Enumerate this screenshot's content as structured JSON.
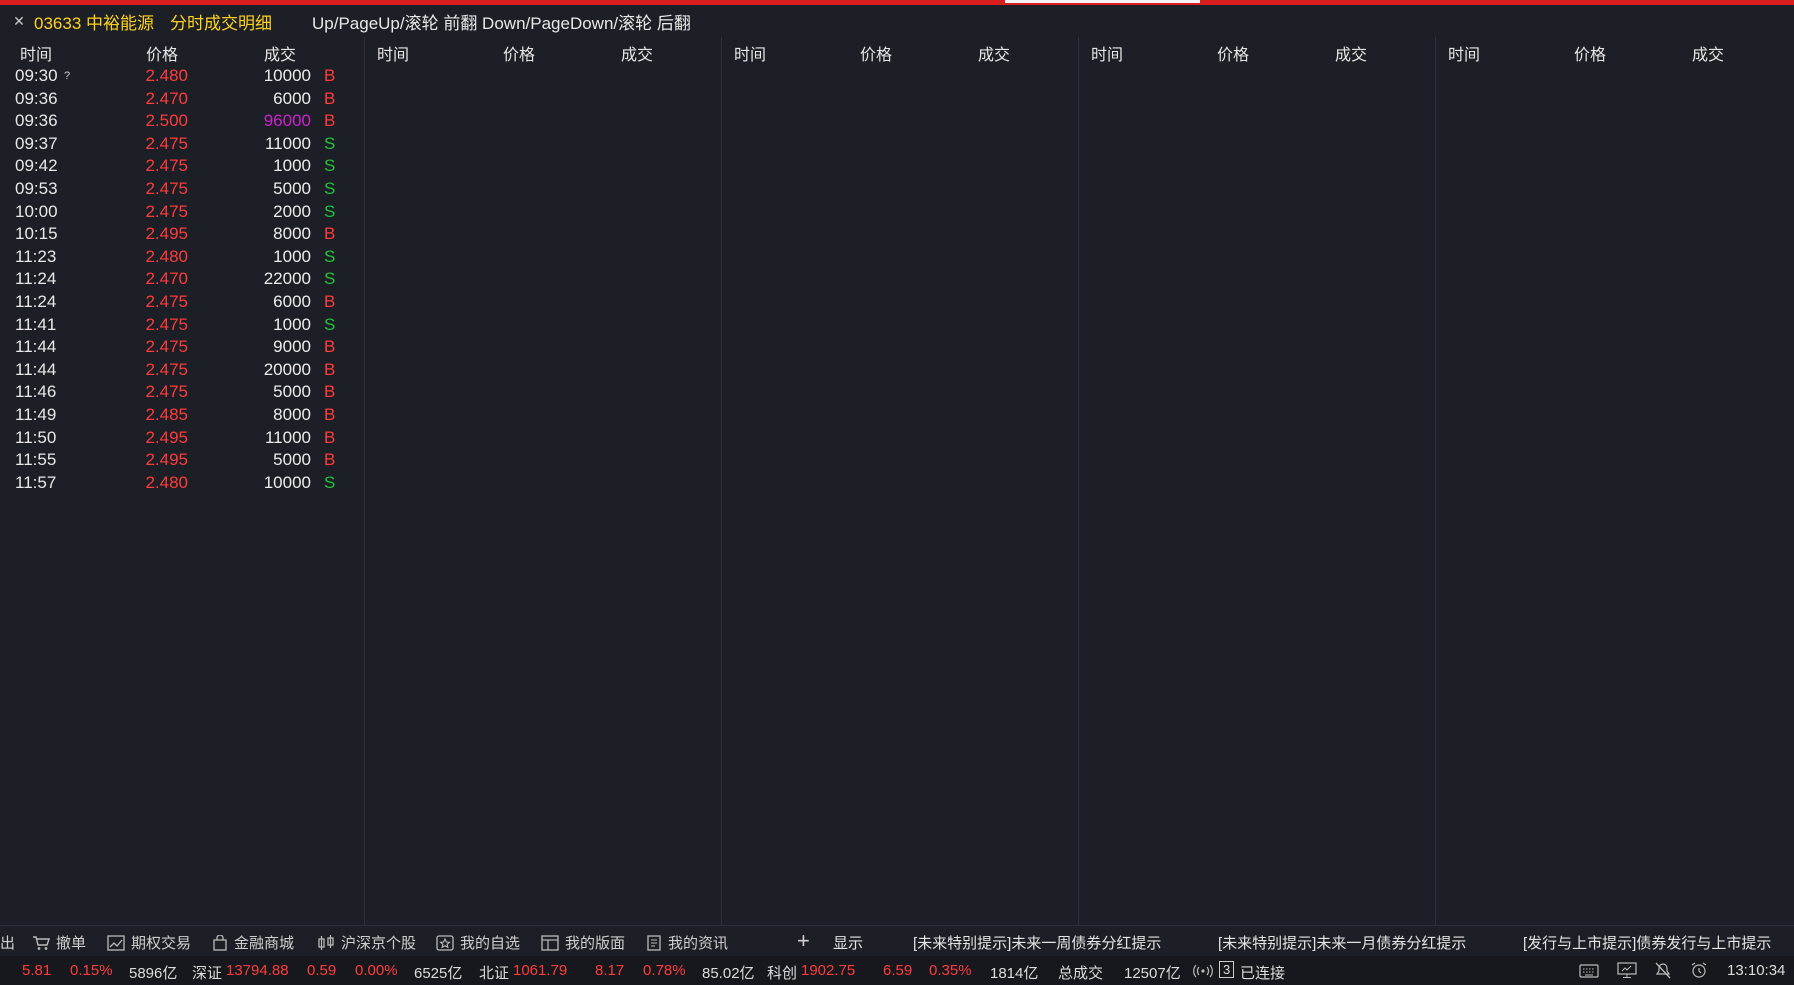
{
  "title": {
    "stock": "03633 中裕能源",
    "mode": "分时成交明细",
    "hint": "Up/PageUp/滚轮 前翻 Down/PageDown/滚轮 后翻"
  },
  "columns": [
    "时间",
    "价格",
    "成交"
  ],
  "trades": [
    {
      "time": "09:30",
      "mark": "?",
      "price": "2.480",
      "vol": "10000",
      "bs": "B",
      "big": false
    },
    {
      "time": "09:36",
      "mark": "",
      "price": "2.470",
      "vol": "6000",
      "bs": "B",
      "big": false
    },
    {
      "time": "09:36",
      "mark": "",
      "price": "2.500",
      "vol": "96000",
      "bs": "B",
      "big": true
    },
    {
      "time": "09:37",
      "mark": "",
      "price": "2.475",
      "vol": "11000",
      "bs": "S",
      "big": false
    },
    {
      "time": "09:42",
      "mark": "",
      "price": "2.475",
      "vol": "1000",
      "bs": "S",
      "big": false
    },
    {
      "time": "09:53",
      "mark": "",
      "price": "2.475",
      "vol": "5000",
      "bs": "S",
      "big": false
    },
    {
      "time": "10:00",
      "mark": "",
      "price": "2.475",
      "vol": "2000",
      "bs": "S",
      "big": false
    },
    {
      "time": "10:15",
      "mark": "",
      "price": "2.495",
      "vol": "8000",
      "bs": "B",
      "big": false
    },
    {
      "time": "11:23",
      "mark": "",
      "price": "2.480",
      "vol": "1000",
      "bs": "S",
      "big": false
    },
    {
      "time": "11:24",
      "mark": "",
      "price": "2.470",
      "vol": "22000",
      "bs": "S",
      "big": false
    },
    {
      "time": "11:24",
      "mark": "",
      "price": "2.475",
      "vol": "6000",
      "bs": "B",
      "big": false
    },
    {
      "time": "11:41",
      "mark": "",
      "price": "2.475",
      "vol": "1000",
      "bs": "S",
      "big": false
    },
    {
      "time": "11:44",
      "mark": "",
      "price": "2.475",
      "vol": "9000",
      "bs": "B",
      "big": false
    },
    {
      "time": "11:44",
      "mark": "",
      "price": "2.475",
      "vol": "20000",
      "bs": "B",
      "big": false
    },
    {
      "time": "11:46",
      "mark": "",
      "price": "2.475",
      "vol": "5000",
      "bs": "B",
      "big": false
    },
    {
      "time": "11:49",
      "mark": "",
      "price": "2.485",
      "vol": "8000",
      "bs": "B",
      "big": false
    },
    {
      "time": "11:50",
      "mark": "",
      "price": "2.495",
      "vol": "11000",
      "bs": "B",
      "big": false
    },
    {
      "time": "11:55",
      "mark": "",
      "price": "2.495",
      "vol": "5000",
      "bs": "B",
      "big": false
    },
    {
      "time": "11:57",
      "mark": "",
      "price": "2.480",
      "vol": "10000",
      "bs": "S",
      "big": false
    }
  ],
  "toolbar": {
    "exit": "出",
    "cancel": "撤单",
    "options": "期权交易",
    "mall": "金融商城",
    "stocks": "沪深京个股",
    "watchlist": "我的自选",
    "layout": "我的版面",
    "news": "我的资讯",
    "plus": "+",
    "show": "显示",
    "msg1": "[未来特别提示]未来一周债券分红提示",
    "msg2": "[未来特别提示]未来一月债券分红提示",
    "msg3": "[发行与上市提示]债券发行与上市提示"
  },
  "status": {
    "sh_chg": "5.81",
    "sh_pct": "0.15%",
    "sh_amt": "5896亿",
    "sz_label": "深证",
    "sz_idx": "13794.88",
    "sz_chg": "0.59",
    "sz_pct": "0.00%",
    "sz_amt": "6525亿",
    "bz_label": "北证",
    "bz_idx": "1061.79",
    "bz_chg": "8.17",
    "bz_pct": "0.78%",
    "bz_amt": "85.02亿",
    "kc_label": "科创",
    "kc_idx": "1902.75",
    "kc_chg": "6.59",
    "kc_pct": "0.35%",
    "kc_amt": "1814亿",
    "total_label": "总成交",
    "total_amt": "12507亿",
    "conn_num": "3",
    "conn": "已连接",
    "clock": "13:10:34"
  },
  "colors": {
    "up": "#ff3b3b",
    "down": "#23c23c",
    "big": "#cc22cc",
    "title": "#ffd21f"
  }
}
